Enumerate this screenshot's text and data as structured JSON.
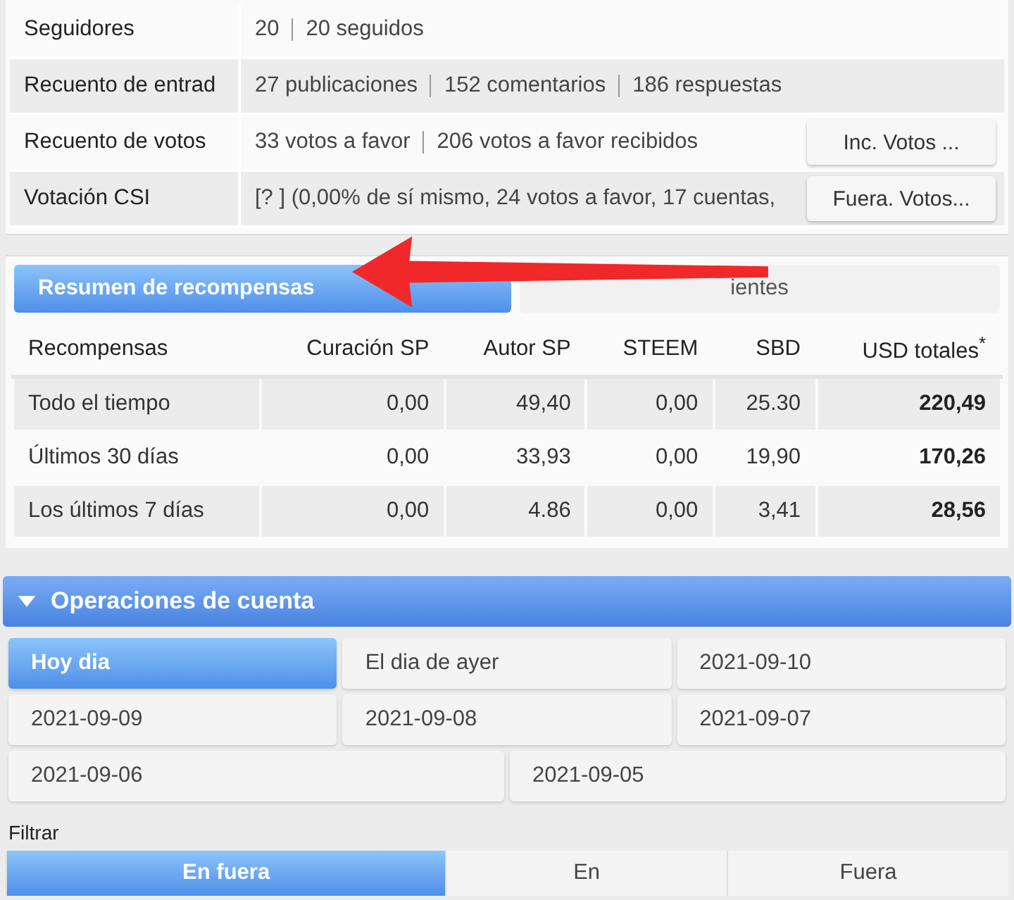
{
  "profile_rows": [
    {
      "label": "Seguidores",
      "values": [
        "20",
        "20 seguidos"
      ]
    },
    {
      "label": "Recuento de entrad",
      "values": [
        "27 publicaciones",
        "152 comentarios",
        "186 respuestas"
      ]
    },
    {
      "label": "Recuento de votos",
      "values": [
        "33 votos a favor",
        "206 votos a favor recibidos"
      ],
      "button": "Inc. Votos ..."
    },
    {
      "label": "Votación CSI",
      "values": [
        "[? ] (0,00% de sí mismo, 24 votos a favor, 17 cuentas,"
      ],
      "button": "Fuera. Votos..."
    }
  ],
  "reward_tabs": [
    {
      "label": "Resumen de recompensas",
      "selected": true
    },
    {
      "label": "ientes",
      "selected": false
    }
  ],
  "rewards_table": {
    "columns": [
      "Recompensas",
      "Curación SP",
      "Autor SP",
      "STEEM",
      "SBD",
      "USD totales$^{*}$"
    ],
    "rows": [
      [
        "Todo el tiempo",
        "0,00",
        "49,40",
        "0,00",
        "25.30",
        "220,49"
      ],
      [
        "Últimos 30 días",
        "0,00",
        "33,93",
        "0,00",
        "19,90",
        "170,26"
      ],
      [
        "Los últimos 7 días",
        "0,00",
        "4.86",
        "0,00",
        "3,41",
        "28,56"
      ]
    ]
  },
  "operations": {
    "title": "Operaciones de cuenta",
    "expanded": true,
    "days": [
      {
        "label": "Hoy dia",
        "selected": true
      },
      {
        "label": "El dia de ayer",
        "selected": false
      },
      {
        "label": "2021-09-10",
        "selected": false
      },
      {
        "label": "2021-09-09",
        "selected": false
      },
      {
        "label": "2021-09-08",
        "selected": false
      },
      {
        "label": "2021-09-07",
        "selected": false
      },
      {
        "label": "2021-09-06",
        "selected": false
      },
      {
        "label": "2021-09-05",
        "selected": false
      }
    ],
    "filter_label": "Filtrar",
    "filters": [
      {
        "label": "En fuera",
        "selected": true
      },
      {
        "label": "En",
        "selected": false
      },
      {
        "label": "Fuera",
        "selected": false
      }
    ]
  }
}
